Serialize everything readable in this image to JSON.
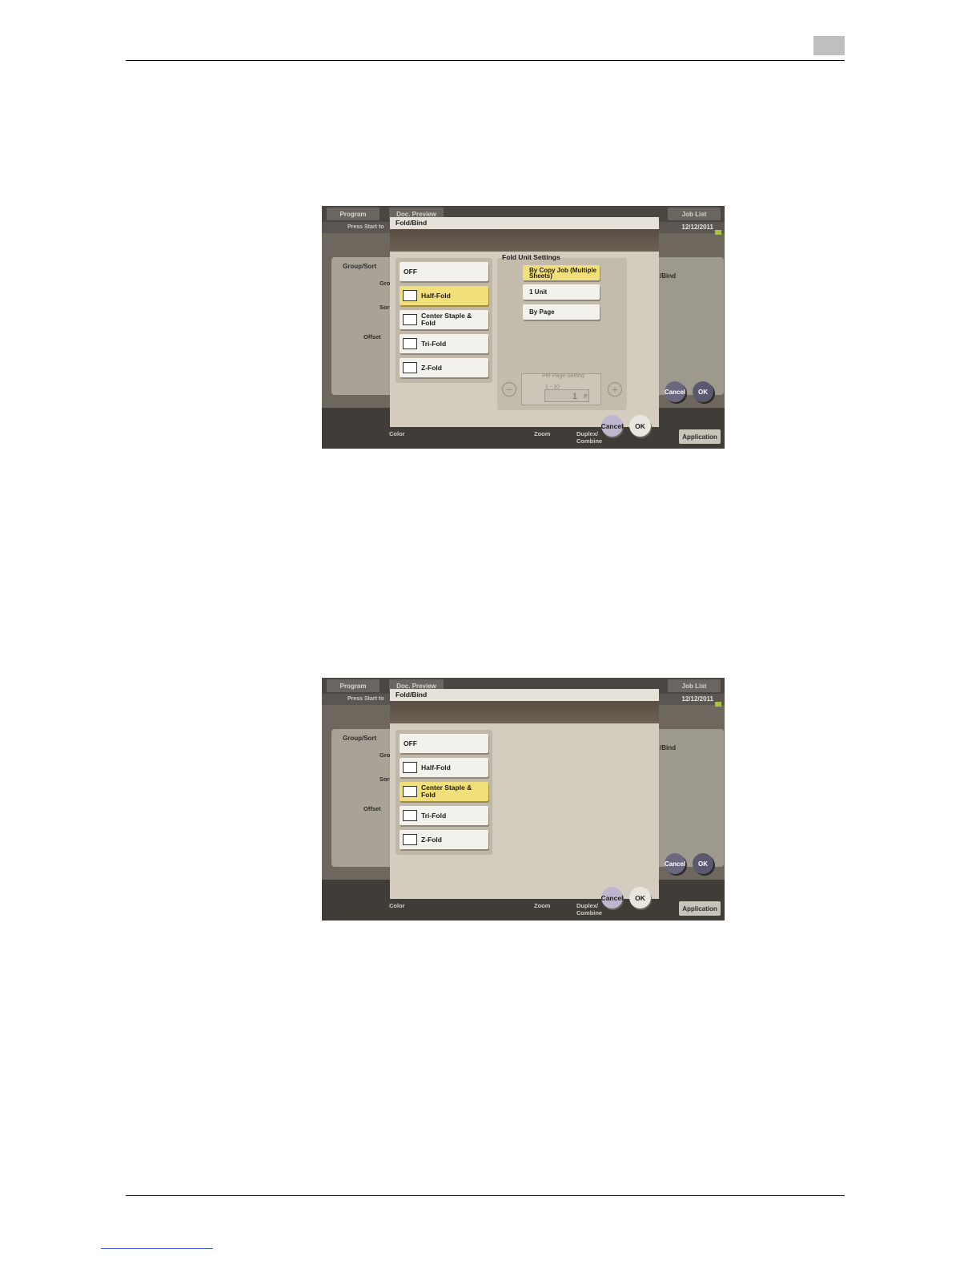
{
  "screens": [
    {
      "background": {
        "tabs": [
          "Program",
          "Doc. Preview",
          "Job List"
        ],
        "strip_text": "Press Start to",
        "date": "12/12/2011",
        "group_sort_label": "Group/Sort",
        "group_label": "Gro",
        "sort_label": "Sor",
        "offset_label": "Offset",
        "right_item": "/Bind",
        "bottom_labels": [
          "Color",
          "Zoom",
          "Duplex/ Combine",
          "Application"
        ],
        "cancel_label": "Cancel",
        "ok_label": "OK"
      },
      "dialog": {
        "title": "Fold/Bind",
        "options": [
          {
            "label": "OFF",
            "icon": "",
            "selected": false
          },
          {
            "label": "Half-Fold",
            "icon": "half-fold-icon",
            "selected": true
          },
          {
            "label": "Center Staple & Fold",
            "icon": "center-staple-icon",
            "selected": false
          },
          {
            "label": "Tri-Fold",
            "icon": "tri-fold-icon",
            "selected": false
          },
          {
            "label": "Z-Fold",
            "icon": "z-fold-icon",
            "selected": false
          }
        ],
        "fold_unit": {
          "title": "Fold Unit Settings",
          "choices": [
            {
              "label": "By Copy Job (Multiple Sheets)",
              "selected": true
            },
            {
              "label": "1 Unit",
              "selected": false
            },
            {
              "label": "By Page",
              "selected": false
            }
          ],
          "per_page_label": "Per Page Setting",
          "range": "1 - 10",
          "value": "1",
          "unit": "P"
        },
        "cancel_label": "Cancel",
        "ok_label": "OK"
      }
    },
    {
      "background": {
        "tabs": [
          "Program",
          "Doc. Preview",
          "Job List"
        ],
        "strip_text": "Press Start to",
        "date": "12/12/2011",
        "group_sort_label": "Group/Sort",
        "group_label": "Gro",
        "sort_label": "Sor",
        "offset_label": "Offset",
        "right_item": "/Bind",
        "bottom_labels": [
          "Color",
          "Zoom",
          "Duplex/ Combine",
          "Application"
        ],
        "cancel_label": "Cancel",
        "ok_label": "OK"
      },
      "dialog": {
        "title": "Fold/Bind",
        "options": [
          {
            "label": "OFF",
            "icon": "",
            "selected": false
          },
          {
            "label": "Half-Fold",
            "icon": "half-fold-icon",
            "selected": false
          },
          {
            "label": "Center Staple & Fold",
            "icon": "center-staple-icon",
            "selected": true
          },
          {
            "label": "Tri-Fold",
            "icon": "tri-fold-icon",
            "selected": false
          },
          {
            "label": "Z-Fold",
            "icon": "z-fold-icon",
            "selected": false
          }
        ],
        "cancel_label": "Cancel",
        "ok_label": "OK"
      }
    }
  ],
  "colors": {
    "selected": "#f1df7a",
    "dialog": "#d4cdbf",
    "band": "#5a4e44"
  }
}
